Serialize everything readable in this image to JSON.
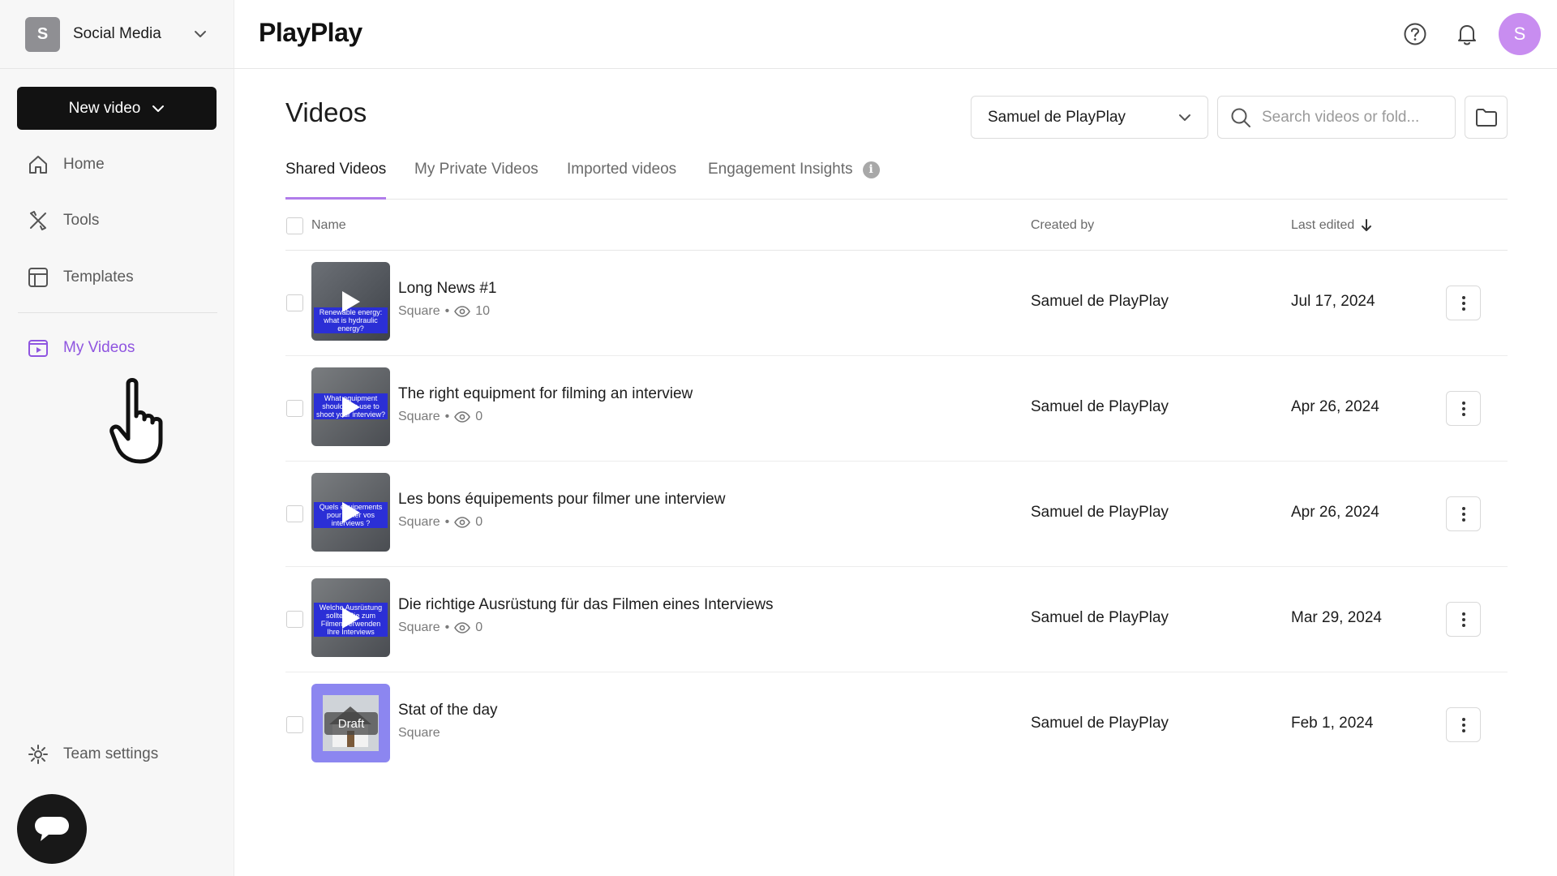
{
  "workspace": {
    "initial": "S",
    "name": "Social Media"
  },
  "sidebar": {
    "new_video_label": "New video",
    "items": [
      {
        "label": "Home",
        "icon": "home-icon"
      },
      {
        "label": "Tools",
        "icon": "tools-icon"
      },
      {
        "label": "Templates",
        "icon": "templates-icon"
      },
      {
        "label": "My Videos",
        "icon": "my-videos-icon",
        "active": true
      }
    ],
    "team_settings_label": "Team settings"
  },
  "header": {
    "logo": "PlayPlay",
    "user_initial": "S"
  },
  "main": {
    "title": "Videos",
    "owner_filter": "Samuel de PlayPlay",
    "search_placeholder": "Search videos or fold...",
    "tabs": [
      {
        "label": "Shared Videos",
        "active": true
      },
      {
        "label": "My Private Videos"
      },
      {
        "label": "Imported videos"
      },
      {
        "label": "Engagement Insights"
      }
    ],
    "columns": {
      "name": "Name",
      "created_by": "Created by",
      "last_edited": "Last edited"
    },
    "rows": [
      {
        "title": "Long News #1",
        "format": "Square",
        "views": "10",
        "creator": "Samuel de PlayPlay",
        "date": "Jul 17, 2024",
        "thumb_text": "Renewable energy: what is hydraulic energy?"
      },
      {
        "title": "The right equipment for filming an interview",
        "format": "Square",
        "views": "0",
        "creator": "Samuel de PlayPlay",
        "date": "Apr 26, 2024",
        "thumb_text": "What equipment should you use to shoot your interview?"
      },
      {
        "title": "Les bons équipements pour filmer une interview",
        "format": "Square",
        "views": "0",
        "creator": "Samuel de PlayPlay",
        "date": "Apr 26, 2024",
        "thumb_text": "Quels équipements pour filmer vos interviews ?"
      },
      {
        "title": "Die richtige Ausrüstung für das Filmen eines Interviews",
        "format": "Square",
        "views": "0",
        "creator": "Samuel de PlayPlay",
        "date": "Mar 29, 2024",
        "thumb_text": "Welche Ausrüstung sollten Sie zum Filmen verwenden Ihre Interviews"
      },
      {
        "title": "Stat of the day",
        "format": "Square",
        "creator": "Samuel de PlayPlay",
        "date": "Feb 1, 2024",
        "draft_label": "Draft"
      }
    ]
  },
  "colors": {
    "accent": "#8f55e0",
    "tab_underline": "#b07cea",
    "primary_button": "#121212",
    "avatar": "#c88df0",
    "draft_thumb": "#8c86f0"
  }
}
